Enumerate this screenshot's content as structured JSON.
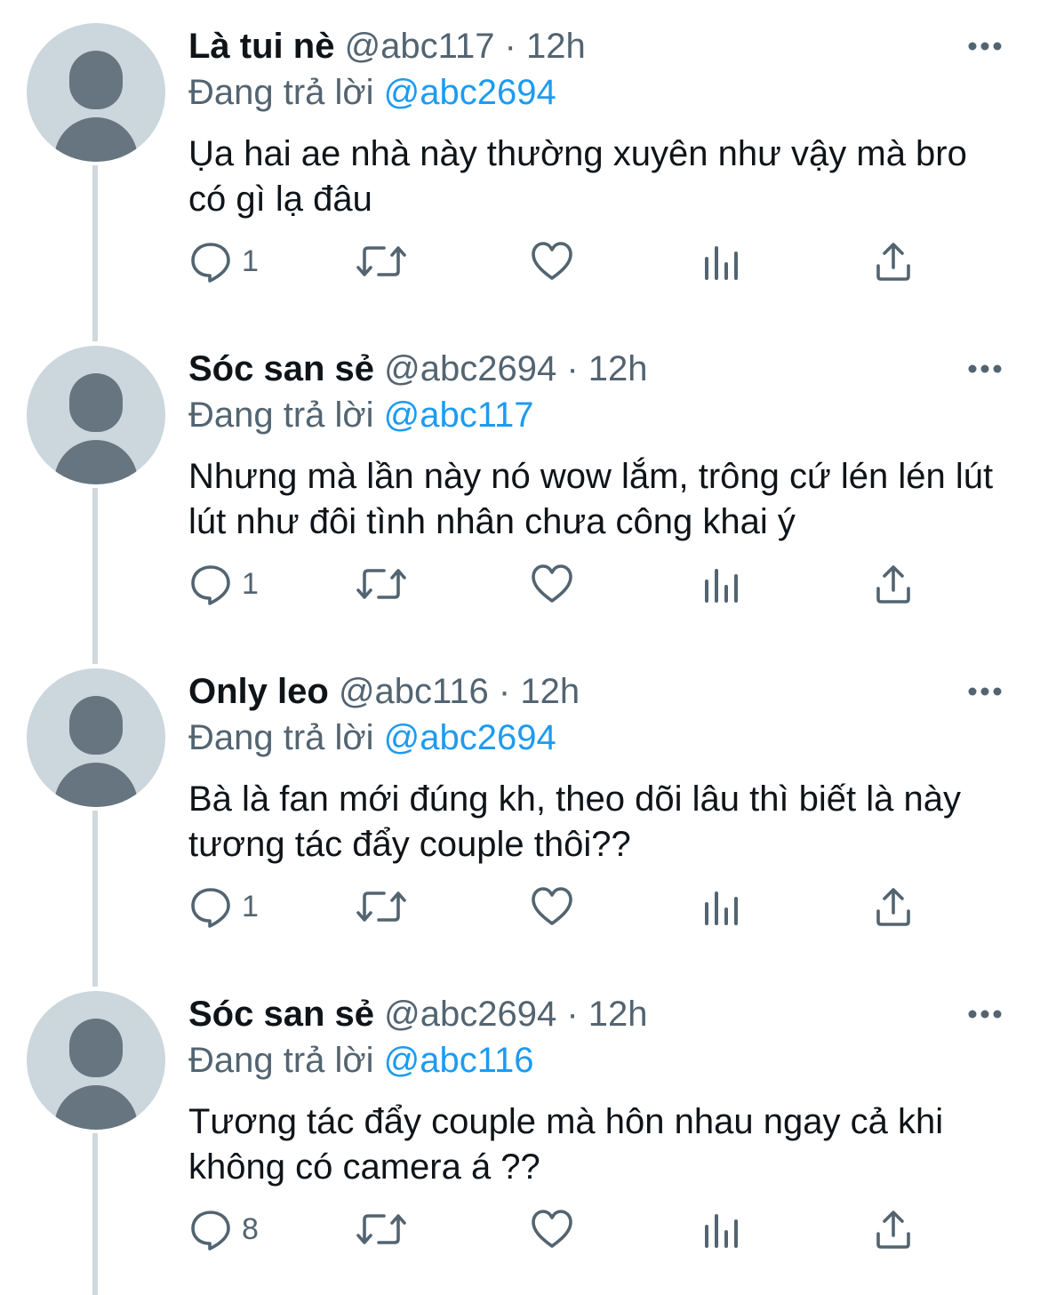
{
  "replying_prefix": "Đang trả lời",
  "tweets": [
    {
      "name": "Là tui nè",
      "handle_time": "@abc117 · 12h",
      "replying_to": "@abc2694",
      "text": "Ụa hai ae nhà này thường xuyên như vậy mà bro có gì lạ đâu",
      "reply_count": "1"
    },
    {
      "name": "Sóc san sẻ",
      "handle_time": "@abc2694 · 12h",
      "replying_to": "@abc117",
      "text": "Nhưng mà lần này nó wow lắm, trông cứ lén lén lút lút như đôi tình nhân chưa công khai ý",
      "reply_count": "1"
    },
    {
      "name": "Only leo",
      "handle_time": "@abc116 · 12h",
      "replying_to": "@abc2694",
      "text": "Bà là fan mới đúng kh, theo dõi lâu thì biết là này tương tác đẩy couple thôi??",
      "reply_count": "1"
    },
    {
      "name": "Sóc san sẻ",
      "handle_time": "@abc2694 · 12h",
      "replying_to": "@abc116",
      "text": "Tương tác đẩy couple mà hôn nhau ngay cả khi không có camera á ??",
      "reply_count": "8"
    }
  ],
  "icons": {
    "reply": "reply-icon",
    "retweet": "retweet-icon",
    "like": "like-icon",
    "views": "views-icon",
    "share": "share-icon",
    "more": "more-icon"
  },
  "colors": {
    "text": "#0f1419",
    "secondary": "#536471",
    "mention": "#1d9bf0",
    "avatar_bg": "#ccd6dd",
    "avatar_fg": "#66757f",
    "thread_line": "#cfd9de"
  }
}
